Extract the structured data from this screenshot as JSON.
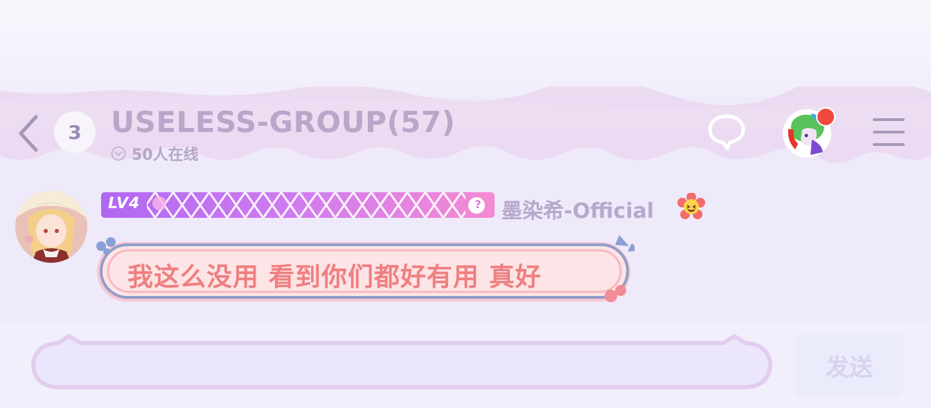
{
  "header": {
    "unread_count": "3",
    "title": "USELESS-GROUP(57)",
    "online_text": "50人在线"
  },
  "message": {
    "level": "LV4",
    "level_help": "?",
    "sender": "墨染希-Official",
    "text": "我这么没用 看到你们都好有用 真好"
  },
  "composer": {
    "input_value": "",
    "send_label": "发送"
  },
  "colors": {
    "accent": "#b9a7c9",
    "bubble_text": "#ef7f80",
    "notification": "#f04a3e"
  },
  "icons": [
    "back-icon",
    "chevron-down-icon",
    "chat-bubble-icon",
    "menu-icon",
    "emoji-flower-icon"
  ]
}
